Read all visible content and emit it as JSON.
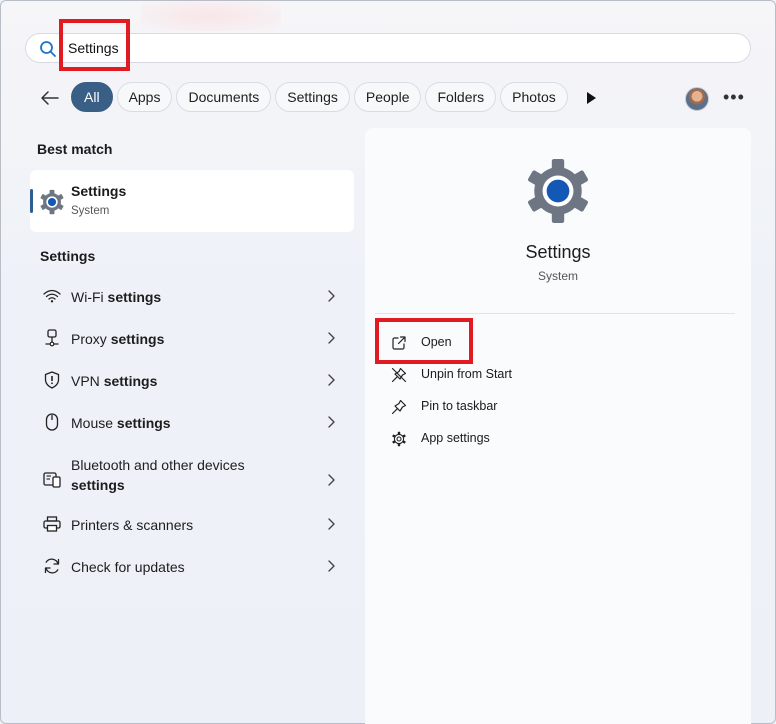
{
  "search": {
    "value": "Settings",
    "placeholder": ""
  },
  "filters": [
    {
      "label": "All",
      "active": true
    },
    {
      "label": "Apps"
    },
    {
      "label": "Documents"
    },
    {
      "label": "Settings"
    },
    {
      "label": "People"
    },
    {
      "label": "Folders"
    },
    {
      "label": "Photos"
    }
  ],
  "left": {
    "best_match_heading": "Best match",
    "best_match": {
      "title": "Settings",
      "subtitle": "System"
    },
    "settings_heading": "Settings",
    "items": [
      {
        "pre": "Wi-Fi ",
        "bold": "settings",
        "icon": "wifi-icon"
      },
      {
        "pre": "Proxy ",
        "bold": "settings",
        "icon": "proxy-icon"
      },
      {
        "pre": "VPN ",
        "bold": "settings",
        "icon": "shield-icon"
      },
      {
        "pre": "Mouse ",
        "bold": "settings",
        "icon": "mouse-icon"
      },
      {
        "pre": "Bluetooth and other devices",
        "bold": "settings",
        "icon": "devices-icon"
      },
      {
        "pre": "Printers & scanners",
        "bold": "",
        "icon": "printer-icon"
      },
      {
        "pre": "Check for updates",
        "bold": "",
        "icon": "update-icon"
      }
    ]
  },
  "right": {
    "title": "Settings",
    "subtitle": "System",
    "actions": [
      {
        "label": "Open",
        "icon": "open-external-icon"
      },
      {
        "label": "Unpin from Start",
        "icon": "unpin-icon"
      },
      {
        "label": "Pin to taskbar",
        "icon": "pin-icon"
      },
      {
        "label": "App settings",
        "icon": "gear-icon"
      }
    ]
  },
  "colors": {
    "accent": "#3a5f86",
    "highlight": "#e11b22"
  }
}
